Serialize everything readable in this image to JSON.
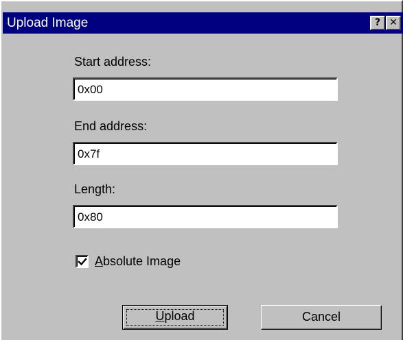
{
  "window": {
    "title": "Upload Image",
    "help_glyph": "?",
    "close_glyph": "✕"
  },
  "fields": {
    "start": {
      "label": "Start address:",
      "value": "0x00"
    },
    "end": {
      "label": "End address:",
      "value": "0x7f"
    },
    "length": {
      "label": "Length:",
      "value": "0x80"
    }
  },
  "absolute_image": {
    "checked": true,
    "access_key": "A",
    "label_rest": "bsolute Image"
  },
  "buttons": {
    "upload": {
      "access_key": "U",
      "label_rest": "pload"
    },
    "cancel": {
      "label": "Cancel"
    }
  },
  "colors": {
    "title_bar": "#000080",
    "face": "#c0c0c0"
  },
  "icons": {
    "help": "help-icon",
    "close": "close-icon",
    "check": "check-icon"
  }
}
